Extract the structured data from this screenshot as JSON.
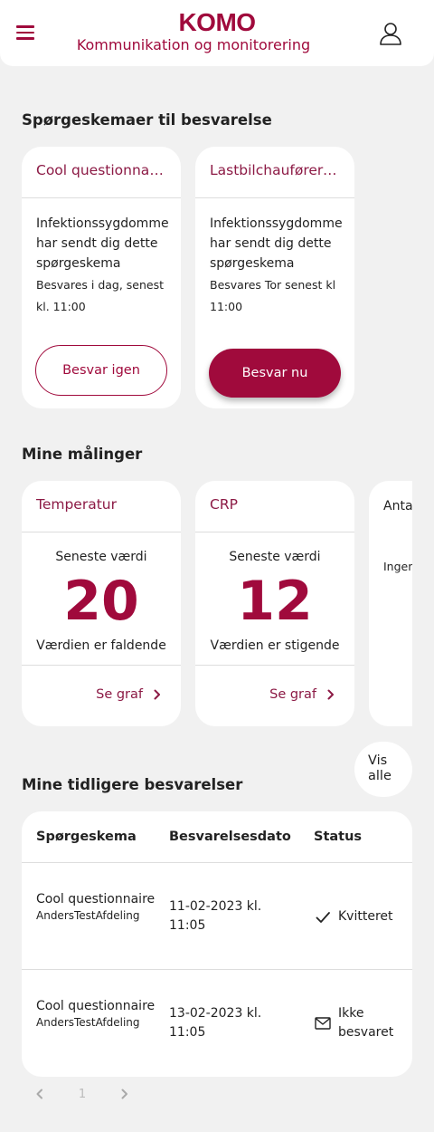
{
  "header": {
    "logo": "KOMO",
    "subtitle": "Kommunikation og monitorering"
  },
  "questionnaires": {
    "title": "Spørgeskemaer til besvarelse",
    "cards": [
      {
        "name": "Cool questionnaire",
        "from": "Infektionssygdomme har sendt dig dette spørgeskema",
        "due": "Besvares i dag, senest kl. 11:00",
        "button": "Besvar igen"
      },
      {
        "name": "Lastbilchauførerne",
        "from": "Infektionssygdomme har sendt dig dette spørgeskema",
        "due": "Besvares Tor senest kl 11:00",
        "button": "Besvar nu"
      }
    ]
  },
  "measurements": {
    "title": "Mine målinger",
    "cards": [
      {
        "name": "Temperatur",
        "label": "Seneste værdi",
        "value": "20",
        "trend": "Værdien er faldende",
        "link": "Se graf"
      },
      {
        "name": "CRP",
        "label": "Seneste værdi",
        "value": "12",
        "trend": "Værdien er stigende",
        "link": "Se graf"
      }
    ],
    "partial": {
      "text": "Antal lastb dag?",
      "sub": "Ingen målin"
    }
  },
  "history": {
    "title": "Mine tidligere besvarelser",
    "show_all": "Vis alle",
    "columns": [
      "Spørgeskema",
      "Besvarelsesdato",
      "Status"
    ],
    "rows": [
      {
        "name": "Cool questionnaire",
        "dept": "AndersTestAfdeling",
        "date": "11-02-2023 kl. 11:05",
        "status": "Kvitteret",
        "status_icon": "check-icon"
      },
      {
        "name": "Cool questionnaire",
        "dept": "AndersTestAfdeling",
        "date": "13-02-2023 kl. 11:05",
        "status": "Ikke besvaret",
        "status_icon": "envelope-icon"
      }
    ]
  },
  "pagination": {
    "current_page": "1"
  },
  "colors": {
    "accent": "#a00a3c",
    "background": "#f1f1f1"
  }
}
